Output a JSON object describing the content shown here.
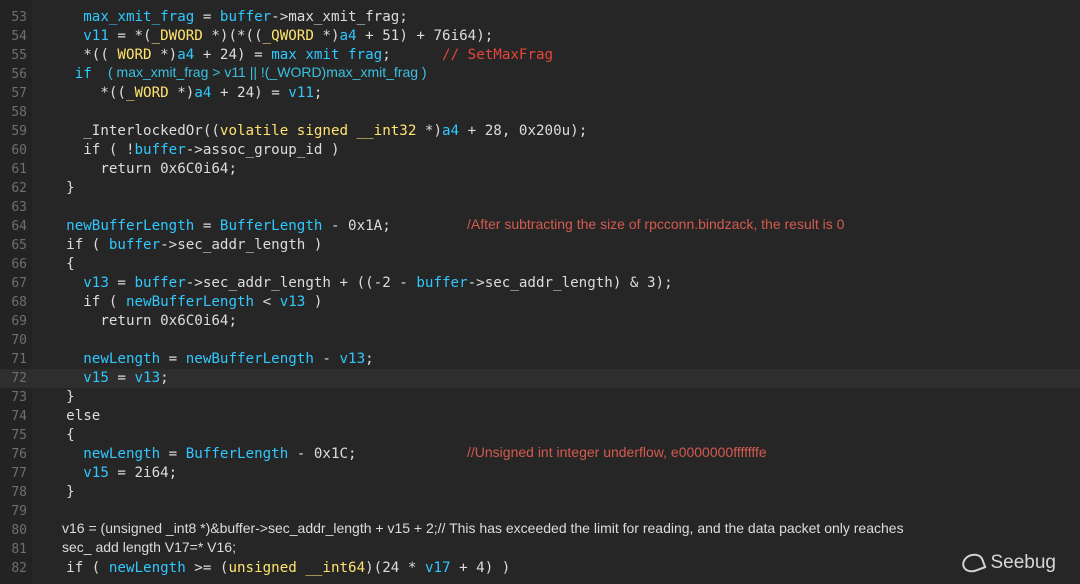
{
  "colors": {
    "background": "#262626",
    "keyword": "#e6e6e6",
    "identifier": "#2fc8ff",
    "type": "#ffe36e",
    "comment": "#e6453a",
    "note_red": "#d45a4f",
    "note_cyan": "#3bc0df"
  },
  "lines": [
    {
      "num": "53",
      "tokens": [
        {
          "t": "      "
        },
        {
          "t": "max_xmit_frag",
          "c": "v"
        },
        {
          "t": " = "
        },
        {
          "t": "buffer",
          "c": "v"
        },
        {
          "t": "->max_xmit_frag;"
        }
      ]
    },
    {
      "num": "54",
      "tokens": [
        {
          "t": "      "
        },
        {
          "t": "v11",
          "c": "v"
        },
        {
          "t": " = *("
        },
        {
          "t": "_DWORD",
          "c": "y"
        },
        {
          "t": " *)(*(("
        },
        {
          "t": "_QWORD",
          "c": "y"
        },
        {
          "t": " *)"
        },
        {
          "t": "a4",
          "c": "v"
        },
        {
          "t": " + 51) + 76i64);"
        }
      ]
    },
    {
      "num": "55",
      "tokens": [
        {
          "t": "      *(( "
        },
        {
          "t": "WORD",
          "c": "y"
        },
        {
          "t": " *)"
        },
        {
          "t": "a4",
          "c": "v"
        },
        {
          "t": " + 24) = "
        },
        {
          "t": "max xmit frag",
          "c": "v"
        },
        {
          "t": ";      "
        },
        {
          "t": "// SetMaxFrag",
          "c": "c"
        }
      ]
    },
    {
      "num": "56",
      "tokens": [
        {
          "t": "     "
        },
        {
          "t": "if",
          "c": "cyan"
        }
      ]
    },
    {
      "num": "57",
      "tokens": [
        {
          "t": "        *(("
        },
        {
          "t": "_WORD",
          "c": "y"
        },
        {
          "t": " *)"
        },
        {
          "t": "a4",
          "c": "v"
        },
        {
          "t": " + 24) = "
        },
        {
          "t": "v11",
          "c": "v"
        },
        {
          "t": ";"
        }
      ]
    },
    {
      "num": "58",
      "tokens": []
    },
    {
      "num": "59",
      "tokens": [
        {
          "t": "      _InterlockedOr(("
        },
        {
          "t": "volatile signed __int32",
          "c": "y"
        },
        {
          "t": " *)"
        },
        {
          "t": "a4",
          "c": "v"
        },
        {
          "t": " + 28, 0x200u);"
        }
      ]
    },
    {
      "num": "60",
      "tokens": [
        {
          "t": "      if ( !"
        },
        {
          "t": "buffer",
          "c": "v"
        },
        {
          "t": "->assoc_group_id )"
        }
      ]
    },
    {
      "num": "61",
      "tokens": [
        {
          "t": "        return 0x6C0i64;"
        }
      ]
    },
    {
      "num": "62",
      "tokens": [
        {
          "t": "    }"
        }
      ]
    },
    {
      "num": "63",
      "tokens": []
    },
    {
      "num": "64",
      "tokens": [
        {
          "t": "    "
        },
        {
          "t": "newBufferLength",
          "c": "v"
        },
        {
          "t": " = "
        },
        {
          "t": "BufferLength",
          "c": "v"
        },
        {
          "t": " - 0x1A;"
        }
      ]
    },
    {
      "num": "65",
      "tokens": [
        {
          "t": "    if ( "
        },
        {
          "t": "buffer",
          "c": "v"
        },
        {
          "t": "->sec_addr_length )"
        }
      ]
    },
    {
      "num": "66",
      "tokens": [
        {
          "t": "    {"
        }
      ]
    },
    {
      "num": "67",
      "tokens": [
        {
          "t": "      "
        },
        {
          "t": "v13",
          "c": "v"
        },
        {
          "t": " = "
        },
        {
          "t": "buffer",
          "c": "v"
        },
        {
          "t": "->sec_addr_length + ((-2 - "
        },
        {
          "t": "buffer",
          "c": "v"
        },
        {
          "t": "->sec_addr_length) & 3);"
        }
      ]
    },
    {
      "num": "68",
      "tokens": [
        {
          "t": "      if ( "
        },
        {
          "t": "newBufferLength",
          "c": "v"
        },
        {
          "t": " < "
        },
        {
          "t": "v13",
          "c": "v"
        },
        {
          "t": " )"
        }
      ]
    },
    {
      "num": "69",
      "tokens": [
        {
          "t": "        return 0x6C0i64;"
        }
      ]
    },
    {
      "num": "70",
      "tokens": []
    },
    {
      "num": "71",
      "tokens": [
        {
          "t": "      "
        },
        {
          "t": "newLength",
          "c": "v"
        },
        {
          "t": " = "
        },
        {
          "t": "newBufferLength",
          "c": "v"
        },
        {
          "t": " - "
        },
        {
          "t": "v13",
          "c": "v"
        },
        {
          "t": ";"
        }
      ]
    },
    {
      "num": "72",
      "tokens": [
        {
          "t": "      "
        },
        {
          "t": "v15",
          "c": "v"
        },
        {
          "t": " = "
        },
        {
          "t": "v13",
          "c": "v"
        },
        {
          "t": ";"
        }
      ]
    },
    {
      "num": "73",
      "tokens": [
        {
          "t": "    }"
        }
      ]
    },
    {
      "num": "74",
      "tokens": [
        {
          "t": "    else"
        }
      ]
    },
    {
      "num": "75",
      "tokens": [
        {
          "t": "    {"
        }
      ]
    },
    {
      "num": "76",
      "tokens": [
        {
          "t": "      "
        },
        {
          "t": "newLength",
          "c": "v"
        },
        {
          "t": " = "
        },
        {
          "t": "BufferLength",
          "c": "v"
        },
        {
          "t": " - 0x1C;"
        }
      ]
    },
    {
      "num": "77",
      "tokens": [
        {
          "t": "      "
        },
        {
          "t": "v15",
          "c": "v"
        },
        {
          "t": " = 2i64;"
        }
      ]
    },
    {
      "num": "78",
      "tokens": [
        {
          "t": "    }"
        }
      ]
    },
    {
      "num": "79",
      "tokens": []
    },
    {
      "num": "80",
      "tokens": []
    },
    {
      "num": "81",
      "tokens": []
    },
    {
      "num": "82",
      "tokens": [
        {
          "t": "    if ( "
        },
        {
          "t": "newLength",
          "c": "v"
        },
        {
          "t": " >= ("
        },
        {
          "t": "unsigned __int64",
          "c": "y"
        },
        {
          "t": ")(24 * "
        },
        {
          "t": "v17",
          "c": "v"
        },
        {
          "t": " + 4) )"
        }
      ]
    }
  ],
  "highlighted_line": "72",
  "annotations": {
    "line56": "( max_xmit_frag > v11 || !(_WORD)max_xmit_frag )",
    "line64": "/After subtracting the size of rpcconn.bindzack, the result is 0",
    "line76": "//Unsigned int integer underflow, e0000000fffffffe",
    "line80": "v16 = (unsigned _int8 *)&buffer->sec_addr_length + v15 + 2;// This has exceeded the limit for reading, and the data packet only reaches",
    "line81": "sec_ add length V17=* V16;"
  },
  "watermark": "Seebug"
}
